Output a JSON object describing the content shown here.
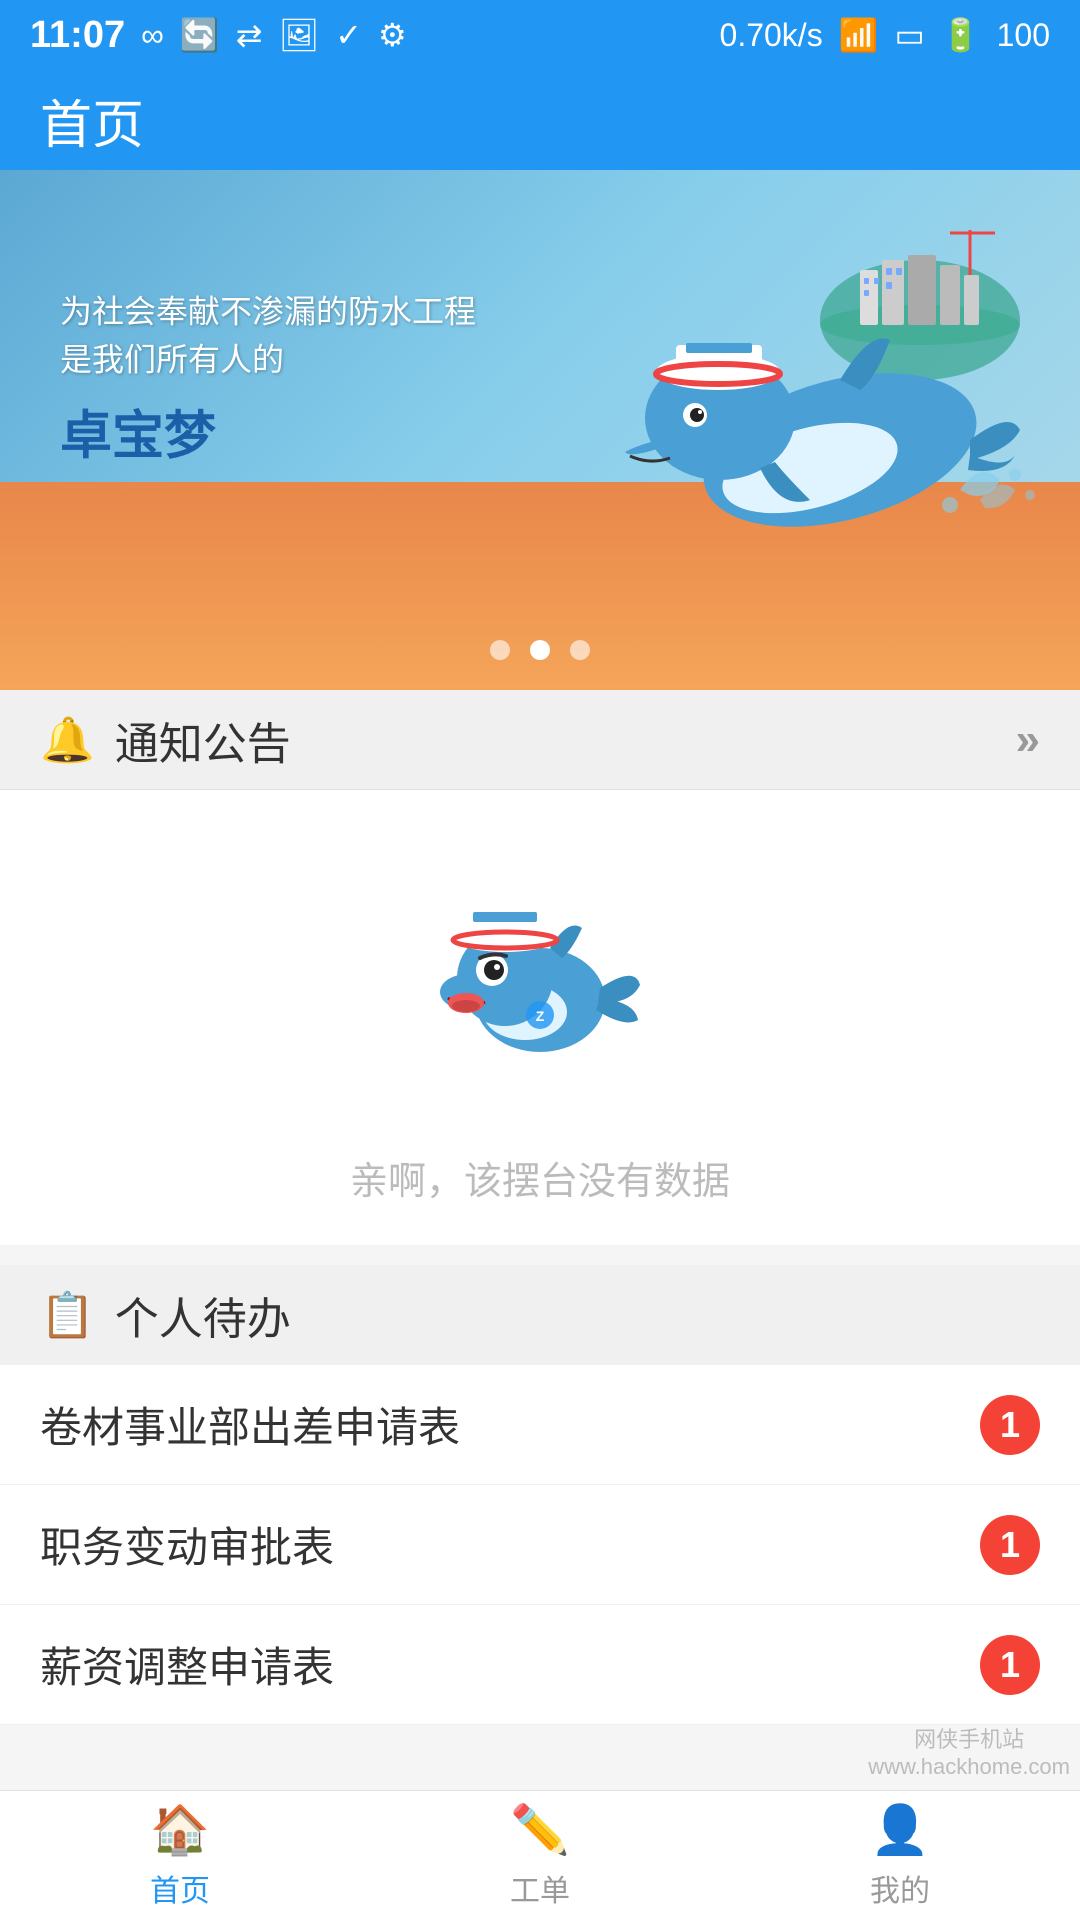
{
  "status_bar": {
    "time": "11:07",
    "signal": "0.70k/s",
    "battery": "100"
  },
  "header": {
    "title": "首页"
  },
  "banner": {
    "slogan_line1": "为社会奉献不渗漏的防水工程",
    "slogan_line2": "是我们所有人的",
    "brand": "卓宝梦",
    "dots": [
      {
        "active": false
      },
      {
        "active": true
      },
      {
        "active": false
      }
    ]
  },
  "notice_section": {
    "icon": "🔔",
    "title": "通知公告",
    "more": "»"
  },
  "empty_state": {
    "text": "亲啊，该摆台没有数据"
  },
  "todo_section": {
    "icon": "📋",
    "title": "个人待办",
    "items": [
      {
        "name": "卷材事业部出差申请表",
        "count": 1
      },
      {
        "name": "职务变动审批表",
        "count": 1
      },
      {
        "name": "薪资调整申请表",
        "count": 1
      }
    ]
  },
  "bottom_nav": {
    "items": [
      {
        "label": "首页",
        "active": true
      },
      {
        "label": "工单",
        "active": false
      },
      {
        "label": "我的",
        "active": false
      }
    ]
  },
  "watermark": {
    "line1": "网侠手机站",
    "line2": "www.hackhome.com"
  }
}
